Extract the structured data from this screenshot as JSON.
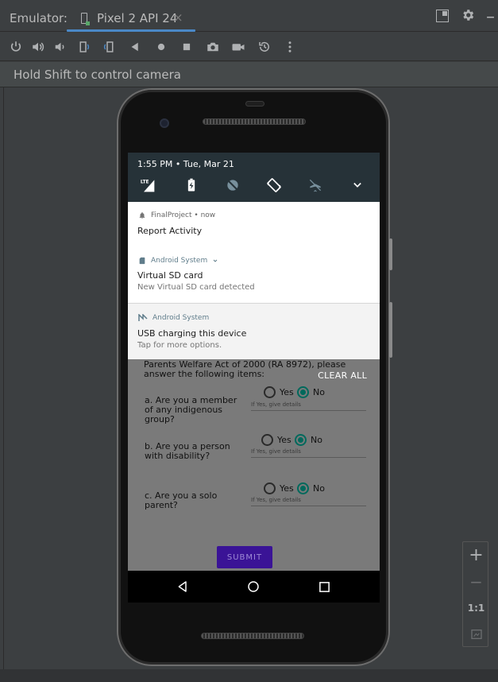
{
  "titlebar": {
    "label": "Emulator:",
    "tab_title": "Pixel 2 API 24",
    "close_glyph": "×"
  },
  "hint": "Hold Shift to control camera",
  "status": {
    "time_date": "1:55 PM • Tue, Mar 21",
    "qs_icons": [
      "lte-signal-icon",
      "battery-charging-icon",
      "dnd-icon",
      "auto-rotate-icon",
      "airplane-mode-icon",
      "chevron-down-icon"
    ]
  },
  "notifications": [
    {
      "app": "FinalProject • now",
      "title": "Report Activity"
    },
    {
      "app": "Android System",
      "title": "Virtual SD card",
      "text": "New Virtual SD card detected"
    },
    {
      "app": "Android System",
      "title": "USB charging this device",
      "text": "Tap for more options."
    }
  ],
  "app": {
    "intro": "Parents Welfare Act of 2000 (RA 8972), please answer the following items:",
    "clear_all": "CLEAR ALL",
    "questions": [
      {
        "q": "a. Are you a member of any indigenous group?",
        "yes": "Yes",
        "no": "No",
        "selected": "No",
        "hint": "If Yes, give details"
      },
      {
        "q": "b. Are you a person with disability?",
        "yes": "Yes",
        "no": "No",
        "selected": "No",
        "hint": "If Yes, give details"
      },
      {
        "q": "c. Are you a solo parent?",
        "yes": "Yes",
        "no": "No",
        "selected": "No",
        "hint": "If Yes, give details"
      }
    ],
    "submit": "SUBMIT"
  },
  "zoom": {
    "plus": "+",
    "minus": "−",
    "one_to_one": "1:1"
  },
  "colors": {
    "accent": "#4a88c7",
    "radio_on": "#00695c",
    "submit_bg": "#3a1396",
    "shade_head": "#263238"
  }
}
